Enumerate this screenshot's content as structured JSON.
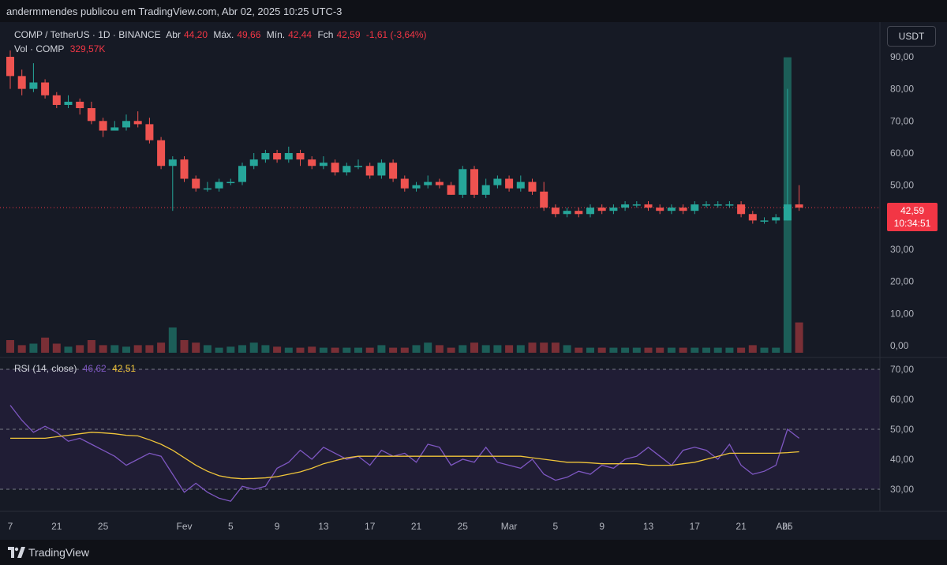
{
  "header": {
    "published_by": "andermmendes publicou em TradingView.com, Abr 02, 2025 10:25 UTC-3"
  },
  "legend": {
    "symbol": "COMP / TetherUS · 1D · BINANCE",
    "open_label": "Abr",
    "open_value": "44,20",
    "high_label": "Máx.",
    "high_value": "49,66",
    "low_label": "Mín.",
    "low_value": "42,44",
    "close_label": "Fch",
    "close_value": "42,59",
    "change": "-1,61 (-3,64%)",
    "vol_label": "Vol · COMP",
    "vol_value": "329,57K",
    "rsi_label": "RSI (14, close)",
    "rsi_value": "46,62",
    "rsi_ma_value": "42,51"
  },
  "currency_button": "USDT",
  "price_tag": {
    "price": "42,59",
    "countdown": "10:34:51"
  },
  "brand": "TradingView",
  "colors": {
    "up": "#26a69a",
    "down": "#ef5350",
    "rsi": "#7e57c2",
    "rsi_ma": "#f0c53a",
    "background": "#161a25"
  },
  "chart_data": {
    "type": "candlestick",
    "price_axis_ticks": [
      "90,00",
      "80,00",
      "70,00",
      "60,00",
      "50,00",
      "40,00",
      "30,00",
      "20,00",
      "10,00",
      "0,00"
    ],
    "rsi_axis_ticks": [
      "70,00",
      "60,00",
      "50,00",
      "40,00",
      "30,00"
    ],
    "x_axis_ticks": [
      "7",
      "21",
      "25",
      "Fev",
      "5",
      "9",
      "13",
      "17",
      "21",
      "25",
      "Mar",
      "5",
      "9",
      "13",
      "17",
      "21",
      "25",
      "Abr"
    ],
    "candles": [
      [
        90,
        84,
        92,
        80
      ],
      [
        84,
        80,
        86,
        78
      ],
      [
        80,
        82,
        88,
        79
      ],
      [
        82,
        78,
        83,
        77
      ],
      [
        78,
        75,
        79,
        74
      ],
      [
        75,
        76,
        78,
        74
      ],
      [
        76,
        74,
        77,
        72
      ],
      [
        74,
        70,
        76,
        69
      ],
      [
        70,
        67,
        71,
        65
      ],
      [
        67,
        68,
        70,
        67
      ],
      [
        68,
        70,
        72,
        67
      ],
      [
        70,
        69,
        73,
        68
      ],
      [
        69,
        64,
        71,
        63
      ],
      [
        64,
        56,
        65,
        55
      ],
      [
        56,
        58,
        59,
        42
      ],
      [
        58,
        52,
        59,
        51
      ],
      [
        52,
        49,
        53,
        48
      ],
      [
        49,
        49,
        51,
        48
      ],
      [
        49,
        51,
        52,
        48
      ],
      [
        51,
        51,
        52,
        50
      ],
      [
        51,
        56,
        57,
        50
      ],
      [
        56,
        58,
        60,
        55
      ],
      [
        58,
        60,
        61,
        57
      ],
      [
        60,
        58,
        61,
        57
      ],
      [
        58,
        60,
        62,
        57
      ],
      [
        60,
        58,
        61,
        56
      ],
      [
        58,
        56,
        59,
        55
      ],
      [
        56,
        57,
        59,
        55
      ],
      [
        57,
        54,
        58,
        53
      ],
      [
        54,
        56,
        57,
        53
      ],
      [
        56,
        56,
        58,
        55
      ],
      [
        56,
        53,
        57,
        52
      ],
      [
        53,
        57,
        58,
        52
      ],
      [
        57,
        52,
        58,
        51
      ],
      [
        52,
        49,
        53,
        48
      ],
      [
        49,
        50,
        51,
        48
      ],
      [
        50,
        51,
        53,
        49
      ],
      [
        51,
        50,
        52,
        49
      ],
      [
        50,
        47,
        51,
        47
      ],
      [
        47,
        55,
        56,
        46
      ],
      [
        55,
        47,
        56,
        46
      ],
      [
        47,
        50,
        52,
        46
      ],
      [
        50,
        52,
        53,
        49
      ],
      [
        52,
        49,
        53,
        48
      ],
      [
        49,
        51,
        53,
        48
      ],
      [
        51,
        48,
        52,
        47
      ],
      [
        48,
        43,
        51,
        42
      ],
      [
        43,
        41,
        44,
        40
      ],
      [
        41,
        42,
        43,
        40
      ],
      [
        42,
        41,
        43,
        40
      ],
      [
        41,
        43,
        44,
        40
      ],
      [
        43,
        42,
        44,
        41
      ],
      [
        42,
        43,
        44,
        41
      ],
      [
        43,
        44,
        45,
        42
      ],
      [
        44,
        44,
        45,
        43
      ],
      [
        44,
        43,
        45,
        42
      ],
      [
        43,
        42,
        44,
        41
      ],
      [
        42,
        43,
        44,
        41
      ],
      [
        43,
        42,
        44,
        41
      ],
      [
        42,
        44,
        45,
        41
      ],
      [
        44,
        44,
        45,
        43
      ],
      [
        44,
        44,
        45,
        43
      ],
      [
        44,
        44,
        45,
        43
      ],
      [
        44,
        41,
        45,
        40
      ],
      [
        41,
        39,
        42,
        38
      ],
      [
        39,
        39,
        40,
        38
      ],
      [
        39,
        40,
        41,
        38
      ],
      [
        39,
        44,
        80,
        39
      ],
      [
        44,
        43,
        50,
        42
      ]
    ],
    "volume": [
      2.5,
      1.5,
      1.8,
      3,
      1.8,
      1.2,
      1.5,
      2.5,
      1.5,
      1.5,
      1.2,
      1.5,
      1.5,
      2,
      5,
      2.5,
      2,
      1.5,
      1,
      1.2,
      1.5,
      2,
      1.5,
      1.2,
      1,
      1,
      1.2,
      1,
      1,
      1,
      1,
      1,
      1.5,
      1,
      1,
      1.5,
      2,
      1.5,
      1,
      1.5,
      2,
      1.5,
      1.5,
      1.5,
      1.5,
      2,
      2,
      2,
      1.5,
      1,
      1,
      1,
      1,
      1,
      1,
      1,
      1,
      1,
      1,
      1,
      1,
      1,
      1,
      1,
      1.5,
      1,
      1,
      24,
      6
    ],
    "rsi": [
      58,
      53,
      49,
      51,
      49,
      46,
      47,
      45,
      43,
      41,
      38,
      40,
      42,
      41,
      35,
      29,
      32,
      29,
      27,
      26,
      31,
      30,
      31,
      37,
      39,
      43,
      40,
      44,
      42,
      40,
      41,
      38,
      43,
      41,
      42,
      39,
      45,
      44,
      38,
      40,
      39,
      44,
      39,
      38,
      37,
      40,
      35,
      33,
      34,
      36,
      35,
      38,
      37,
      40,
      41,
      44,
      41,
      38,
      43,
      44,
      43,
      40,
      45,
      38,
      35,
      36,
      38,
      50,
      47
    ],
    "rsi_ma": [
      47,
      47,
      47,
      47,
      47.5,
      48,
      48.5,
      49,
      48.8,
      48.5,
      48,
      47.8,
      46.5,
      45,
      43,
      40.5,
      38,
      36,
      34.5,
      33.8,
      33.5,
      33.6,
      33.8,
      34.2,
      35,
      35.8,
      37,
      38.5,
      39.5,
      40.5,
      41,
      41,
      41,
      41,
      41,
      41,
      41,
      41,
      41,
      41,
      41,
      41,
      41,
      41,
      41,
      40.5,
      40,
      39.5,
      39,
      39,
      38.8,
      38.5,
      38.5,
      38.5,
      38.5,
      38,
      38,
      38,
      38.5,
      39,
      40,
      41,
      42,
      42,
      42,
      42,
      42,
      42.2,
      42.5
    ]
  }
}
